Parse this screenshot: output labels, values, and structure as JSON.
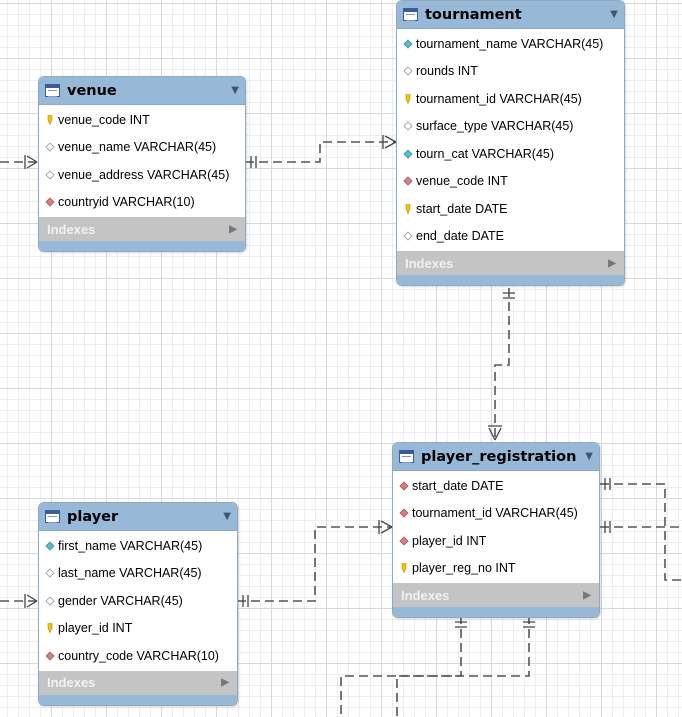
{
  "indexes_label": "Indexes",
  "colors": {
    "header": "#98b8d8",
    "pk_key": "#f5c400",
    "fk": "#d77f7f",
    "nn": "#5cbcc8",
    "col": "#ffffff"
  },
  "entities": {
    "venue": {
      "title": "venue",
      "columns": [
        {
          "name": "venue_code INT",
          "icon": "primary-key-icon"
        },
        {
          "name": "venue_name VARCHAR(45)",
          "icon": "column-icon"
        },
        {
          "name": "venue_address VARCHAR(45)",
          "icon": "column-icon"
        },
        {
          "name": "countryid VARCHAR(10)",
          "icon": "foreign-key-icon"
        }
      ]
    },
    "tournament": {
      "title": "tournament",
      "columns": [
        {
          "name": "tournament_name VARCHAR(45)",
          "icon": "not-null-column-icon"
        },
        {
          "name": "rounds INT",
          "icon": "column-icon"
        },
        {
          "name": "tournament_id VARCHAR(45)",
          "icon": "primary-key-icon"
        },
        {
          "name": "surface_type VARCHAR(45)",
          "icon": "column-icon"
        },
        {
          "name": "tourn_cat VARCHAR(45)",
          "icon": "not-null-column-icon"
        },
        {
          "name": "venue_code INT",
          "icon": "foreign-key-icon"
        },
        {
          "name": "start_date DATE",
          "icon": "primary-key-icon"
        },
        {
          "name": "end_date DATE",
          "icon": "column-icon"
        }
      ]
    },
    "player_registration": {
      "title": "player_registration",
      "columns": [
        {
          "name": "start_date DATE",
          "icon": "foreign-key-icon"
        },
        {
          "name": "tournament_id VARCHAR(45)",
          "icon": "foreign-key-icon"
        },
        {
          "name": "player_id INT",
          "icon": "foreign-key-icon"
        },
        {
          "name": "player_reg_no INT",
          "icon": "primary-key-icon"
        }
      ]
    },
    "player": {
      "title": "player",
      "columns": [
        {
          "name": "first_name VARCHAR(45)",
          "icon": "not-null-column-icon"
        },
        {
          "name": "last_name VARCHAR(45)",
          "icon": "column-icon"
        },
        {
          "name": "gender VARCHAR(45)",
          "icon": "column-icon"
        },
        {
          "name": "player_id INT",
          "icon": "primary-key-icon"
        },
        {
          "name": "country_code VARCHAR(10)",
          "icon": "foreign-key-icon"
        }
      ]
    }
  }
}
